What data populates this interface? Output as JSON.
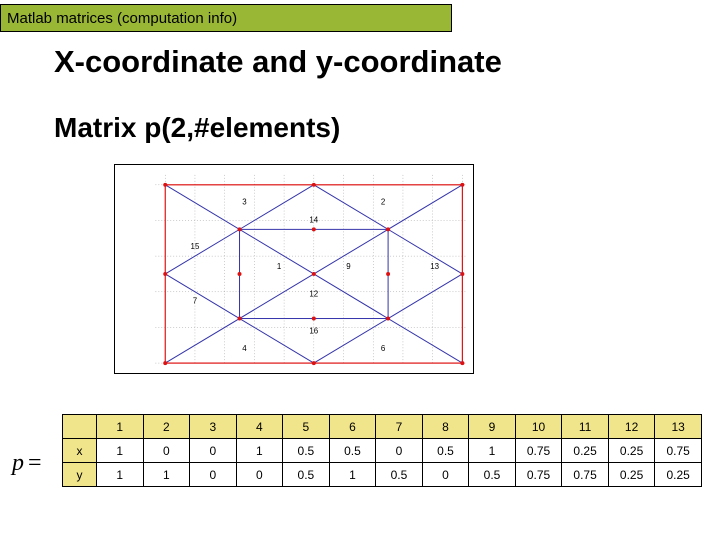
{
  "banner": "Matlab matrices (computation info)",
  "title": "X-coordinate and y-coordinate",
  "subtitle": "Matrix  p(2,#elements)",
  "equation": {
    "var": "p",
    "eq": "="
  },
  "table": {
    "row_labels": [
      "x",
      "y"
    ],
    "cols": [
      "1",
      "2",
      "3",
      "4",
      "5",
      "6",
      "7",
      "8",
      "9",
      "10",
      "11",
      "12",
      "13"
    ],
    "rows": [
      [
        "1",
        "0",
        "0",
        "1",
        "0.5",
        "0.5",
        "0",
        "0.5",
        "1",
        "0.75",
        "0.25",
        "0.25",
        "0.75"
      ],
      [
        "1",
        "1",
        "0",
        "0",
        "0.5",
        "1",
        "0.5",
        "0",
        "0.5",
        "0.75",
        "0.75",
        "0.25",
        "0.25"
      ]
    ]
  },
  "mesh": {
    "region_labels": [
      "3",
      "2",
      "14",
      "15",
      "1",
      "9",
      "13",
      "7",
      "12",
      "16",
      "4",
      "6"
    ],
    "axes_x_ticks": [
      "0",
      "0.1",
      "0.2",
      "0.3",
      "0.4",
      "0.5",
      "0.6",
      "0.7",
      "0.8",
      "0.9",
      "1"
    ],
    "axes_y_ticks": [
      "0",
      "0.2",
      "0.4",
      "0.6",
      "0.8",
      "1"
    ]
  },
  "chart_data": {
    "type": "table",
    "title": "Matrix p(2,#elements)",
    "categories": [
      1,
      2,
      3,
      4,
      5,
      6,
      7,
      8,
      9,
      10,
      11,
      12,
      13
    ],
    "series": [
      {
        "name": "x",
        "values": [
          1,
          0,
          0,
          1,
          0.5,
          0.5,
          0,
          0.5,
          1,
          0.75,
          0.25,
          0.25,
          0.75
        ]
      },
      {
        "name": "y",
        "values": [
          1,
          1,
          0,
          0,
          0.5,
          1,
          0.5,
          0,
          0.5,
          0.75,
          0.75,
          0.25,
          0.25
        ]
      }
    ]
  }
}
